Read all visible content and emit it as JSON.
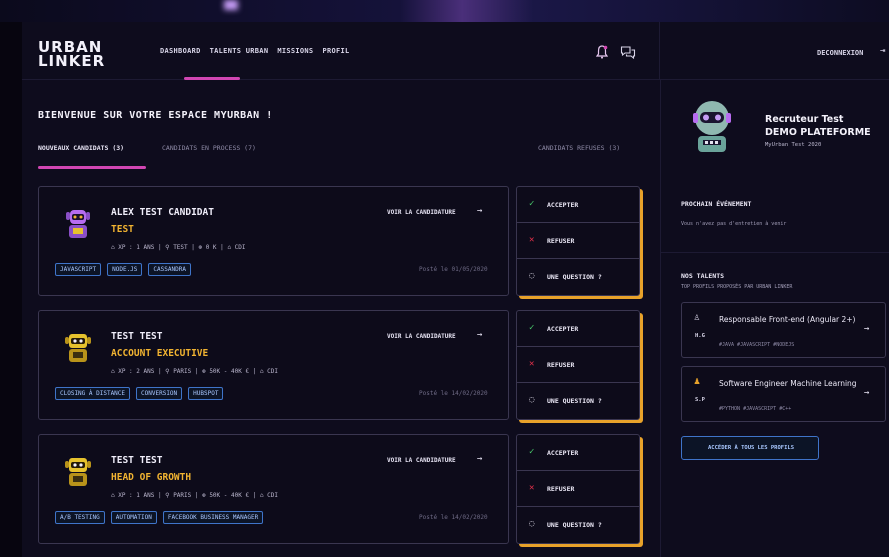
{
  "header": {
    "logo_line1": "URBAN",
    "logo_line2": "LINKER",
    "nav": [
      "DASHBOARD",
      "TALENTS URBAN",
      "MISSIONS",
      "PROFIL"
    ],
    "logout": "DECONNEXION",
    "logout_icon": "⇥"
  },
  "main": {
    "welcome": "BIENVENUE SUR VOTRE ESPACE MYURBAN !",
    "tabs": [
      {
        "label": "NOUVEAUX CANDIDATS (3)",
        "active": true
      },
      {
        "label": "CANDIDATS EN PROCESS (7)",
        "active": false
      },
      {
        "label": "CANDIDATS REFUSES (3)",
        "active": false
      }
    ],
    "view_label": "VOIR LA CANDIDATURE",
    "arrow": "→",
    "actions": {
      "accept": "ACCEPTER",
      "refuse": "REFUSER",
      "question": "UNE QUESTION ?"
    },
    "action_icons": {
      "accept": "✓",
      "refuse": "✕",
      "question": "◌"
    },
    "candidates": [
      {
        "name": "ALEX TEST CANDIDAT",
        "role": "TEST",
        "meta": "⌂ XP : 1 ANS  |  ⚲ TEST  |  ⊛ 0 K  |  ⌂ CDI",
        "tags": [
          "JAVASCRIPT",
          "NODE.JS",
          "CASSANDRA"
        ],
        "posted": "Posté le 01/05/2020",
        "avatar_color": "#b76cf0"
      },
      {
        "name": "TEST TEST",
        "role": "ACCOUNT EXECUTIVE",
        "meta": "⌂ XP : 2 ANS  |  ⚲ PARIS  |  ⊛ 50K - 40K €  |  ⌂ CDI",
        "tags": [
          "CLOSING À DISTANCE",
          "CONVERSION",
          "HUBSPOT"
        ],
        "posted": "Posté le 14/02/2020",
        "avatar_color": "#e6c22d"
      },
      {
        "name": "TEST TEST",
        "role": "HEAD OF GROWTH",
        "meta": "⌂ XP : 1 ANS  |  ⚲ PARIS  |  ⊛ 50K - 40K €  |  ⌂ CDI",
        "tags": [
          "A/B TESTING",
          "AUTOMATION",
          "FACEBOOK BUSINESS MANAGER"
        ],
        "posted": "Posté le 14/02/2020",
        "avatar_color": "#e6c22d"
      }
    ]
  },
  "sidebar": {
    "name_line1": "Recruteur Test",
    "name_line2": "DEMO PLATEFORME",
    "subtitle": "MyUrban Test 2020",
    "next_event_title": "PROCHAIN ÉVÉNEMENT",
    "next_event_text": "Vous n'avez pas d'entretien à venir",
    "talents_title": "NOS TALENTS",
    "talents_subtitle": "TOP PROFILS PROPOSÉS PAR URBAN LINKER",
    "talents": [
      {
        "icon": "♙",
        "initials": "H.G",
        "title": "Responsable Front-end (Angular 2+)",
        "tags": "#JAVA #JAVASCRIPT #NODEJS"
      },
      {
        "icon": "♟",
        "initials": "S.P",
        "title": "Software Engineer Machine Learning",
        "tags": "#PYTHON #JAVASCRIPT #C++"
      }
    ],
    "all_profiles": "ACCÉDER À TOUS LES PROFILS"
  },
  "colors": {
    "accent_pink": "#d146b3",
    "accent_gold": "#f2b431",
    "tag_blue": "#3f74c9",
    "accept_green": "#48c76b",
    "refuse_red": "#e0304a"
  }
}
